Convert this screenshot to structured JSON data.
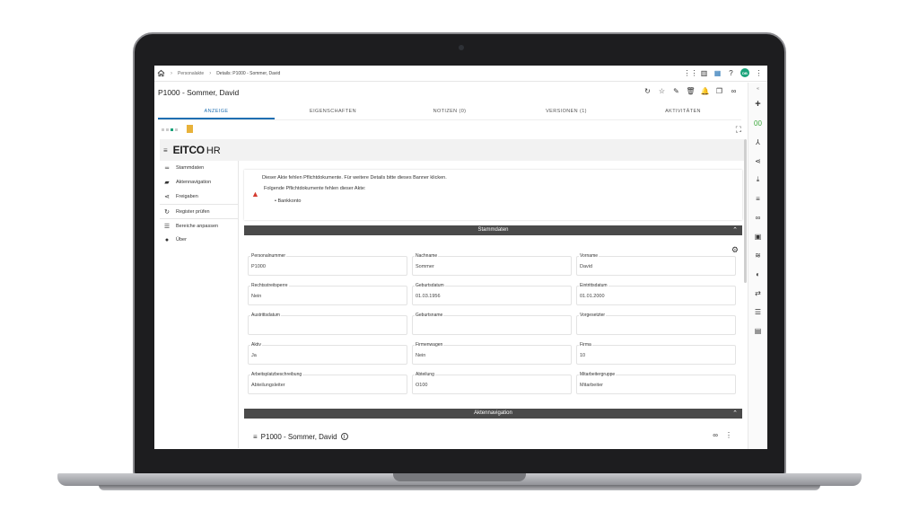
{
  "breadcrumb": {
    "items": [
      "Personalakte",
      "Details: P1000 - Sommer, David"
    ]
  },
  "user": {
    "initials": "DB"
  },
  "title": "P1000 - Sommer, David",
  "tabs": [
    {
      "label": "ANZEIGE",
      "active": true
    },
    {
      "label": "EIGENSCHAFTEN",
      "active": false
    },
    {
      "label": "NOTIZEN (0)",
      "active": false
    },
    {
      "label": "VERSIONEN (1)",
      "active": false
    },
    {
      "label": "AKTIVITÄTEN",
      "active": false
    }
  ],
  "app": {
    "logo_main": "EITCO",
    "logo_sub": "HR"
  },
  "sidenav": [
    {
      "label": "Stammdaten",
      "icon": "filter-lines-icon"
    },
    {
      "label": "Aktennavigation",
      "icon": "folder-icon"
    },
    {
      "label": "Freigaben",
      "icon": "share-icon"
    },
    {
      "label": "Register prüfen",
      "icon": "refresh-check-icon"
    },
    {
      "label": "Bereiche anpassen",
      "icon": "list-icon"
    },
    {
      "label": "Über",
      "icon": "info-icon"
    }
  ],
  "banner": {
    "line1": "Dieser Akte fehlen Pflichtdokumente. Für weitere Details bitte dieses Banner klicken.",
    "line2": "Folgende Pflichtdokumente fehlen dieser Akte:",
    "item": "Bankkonto"
  },
  "sections": {
    "stammdaten": "Stammdaten",
    "aktennavigation": "Aktennavigation"
  },
  "fields": [
    {
      "label": "Personalnummer",
      "value": "P1000"
    },
    {
      "label": "Nachname",
      "value": "Sommer"
    },
    {
      "label": "Vorname",
      "value": "David"
    },
    {
      "label": "Rechtsstreitsperre",
      "value": "Nein"
    },
    {
      "label": "Geburtsdatum",
      "value": "01.03.1956"
    },
    {
      "label": "Eintrittsdatum",
      "value": "01.01.2000"
    },
    {
      "label": "Austrittsdatum",
      "value": ""
    },
    {
      "label": "Geburtsname",
      "value": ""
    },
    {
      "label": "Vorgesetzter",
      "value": ""
    },
    {
      "label": "Aktiv",
      "value": "Ja"
    },
    {
      "label": "Firmenwagen",
      "value": "Nein"
    },
    {
      "label": "Firma",
      "value": "10"
    },
    {
      "label": "Arbeitsplatzbeschreibung",
      "value": "Abteilungsleiter"
    },
    {
      "label": "Abteilung",
      "value": "O100"
    },
    {
      "label": "Mitarbeitergruppe",
      "value": "Mitarbeiter"
    }
  ],
  "akten_title": "P1000 - Sommer, David",
  "colors": {
    "accent": "#1f6fb2",
    "avatar": "#1aa37a",
    "warning": "#d43a2f",
    "section_bar": "#4a4a4a"
  }
}
